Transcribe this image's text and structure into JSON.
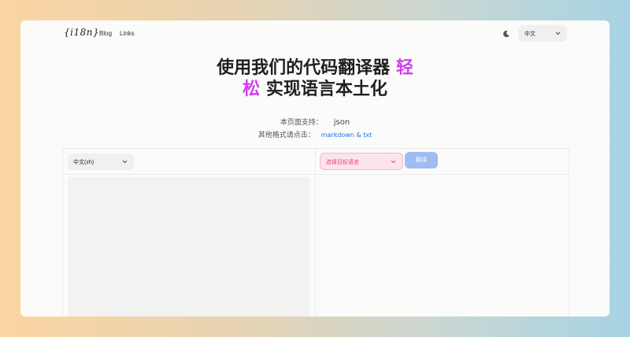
{
  "nav": {
    "logo": "{i18n}",
    "links": [
      "Blog",
      "Links"
    ],
    "language_select": {
      "value": "中文"
    },
    "theme_icon": "moon-icon"
  },
  "hero": {
    "title_part1": "使用我们的代码翻译器 ",
    "title_accent1": "轻",
    "title_accent2": "松",
    "title_part2": " 实现语言本土化",
    "accent_color": "#d43cf0"
  },
  "support": {
    "label": "本页面支持：",
    "format": "json"
  },
  "other_formats": {
    "label": "其他格式请点击：",
    "link": "markdown & txt",
    "link_color": "#1d6fd8"
  },
  "editor": {
    "source_language": "中文(zh)",
    "target_placeholder": "选择目标语言",
    "translate_label": "翻译",
    "button_color": "#9fbdf4"
  }
}
